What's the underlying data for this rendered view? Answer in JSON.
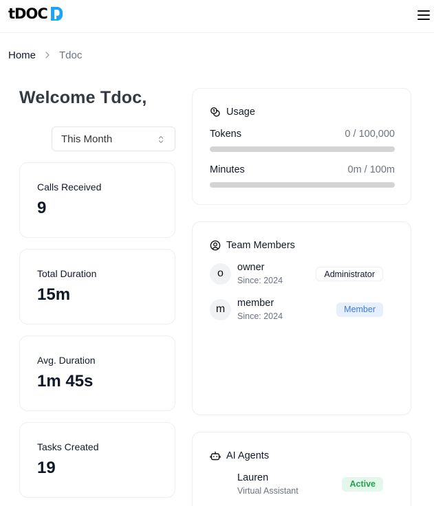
{
  "header": {
    "logo_text": "tDOC",
    "brand_color": "#1aa6f0",
    "menu_icon": "hamburger-menu-icon"
  },
  "breadcrumb": {
    "home": "Home",
    "current": "Tdoc"
  },
  "welcome": "Welcome Tdoc,",
  "period_select": {
    "value": "This Month"
  },
  "stats": [
    {
      "label": "Calls Received",
      "value": "9"
    },
    {
      "label": "Total Duration",
      "value": "15m"
    },
    {
      "label": "Avg. Duration",
      "value": "1m 45s"
    },
    {
      "label": "Tasks Created",
      "value": "19"
    }
  ],
  "usage": {
    "title": "Usage",
    "icon": "coins-icon",
    "rows": [
      {
        "label": "Tokens",
        "value": "0 / 100,000",
        "fraction": 0
      },
      {
        "label": "Minutes",
        "value": "0m / 100m",
        "fraction": 0
      }
    ]
  },
  "team": {
    "title": "Team Members",
    "icon": "user-circle-icon",
    "members": [
      {
        "initial": "o",
        "name": "owner",
        "since": "Since: 2024",
        "role": "Administrator"
      },
      {
        "initial": "m",
        "name": "member",
        "since": "Since: 2024",
        "role": "Member"
      }
    ]
  },
  "agents": {
    "title": "AI Agents",
    "icon": "bot-icon",
    "items": [
      {
        "name": "Lauren",
        "role": "Virtual Assistant",
        "status": "Active"
      }
    ]
  }
}
